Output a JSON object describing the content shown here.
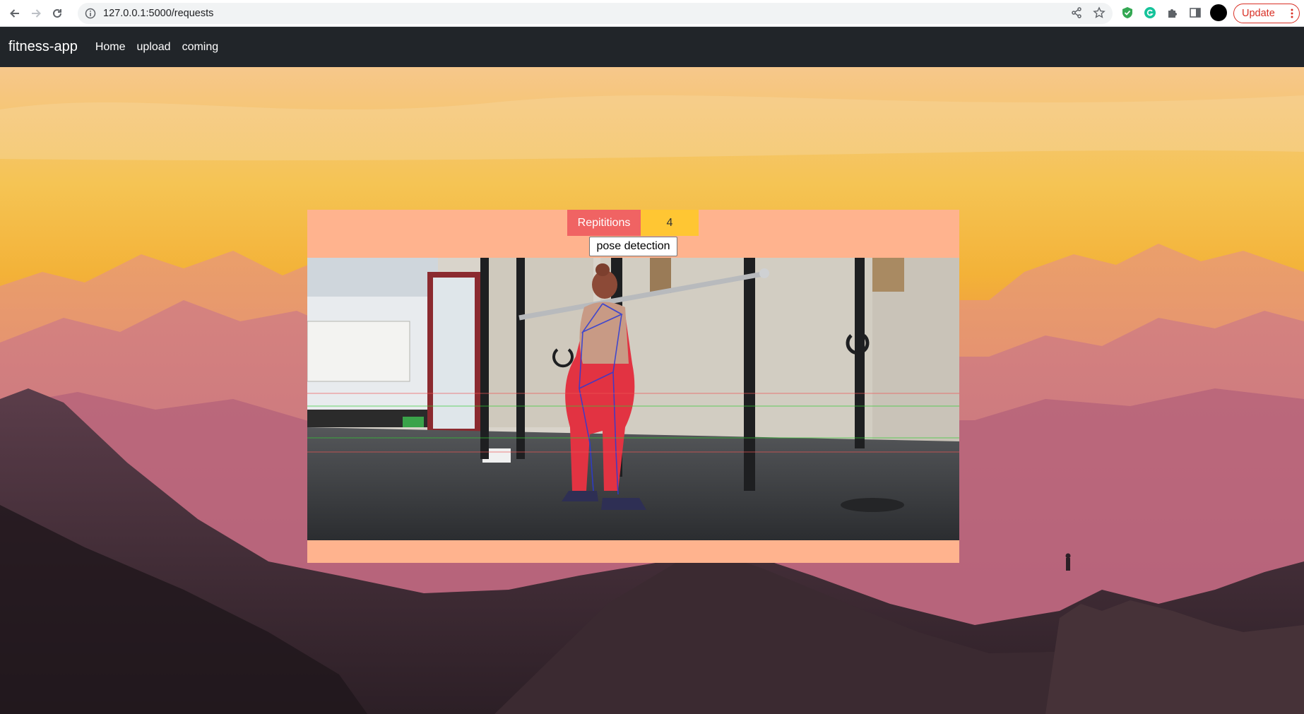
{
  "browser": {
    "url": "127.0.0.1:5000/requests",
    "update_label": "Update"
  },
  "navbar": {
    "brand": "fitness-app",
    "links": [
      "Home",
      "upload",
      "coming"
    ]
  },
  "counter": {
    "label": "Repititions",
    "value": "4"
  },
  "video": {
    "tooltip": "pose detection"
  },
  "icons": {
    "back": "arrow-left-icon",
    "forward": "arrow-right-icon",
    "reload": "reload-icon",
    "site_info": "info-icon",
    "share": "share-icon",
    "bookmark": "star-icon",
    "extensions": [
      "shield-extension-icon",
      "grammarly-icon",
      "puzzle-icon",
      "sidepanel-icon"
    ],
    "menu": "kebab-menu-icon"
  },
  "colors": {
    "navbar_bg": "#212529",
    "panel_bg": "#ffb38e",
    "reps_label_bg": "#f06363",
    "reps_value_bg": "#ffc633",
    "update_accent": "#d93025"
  }
}
